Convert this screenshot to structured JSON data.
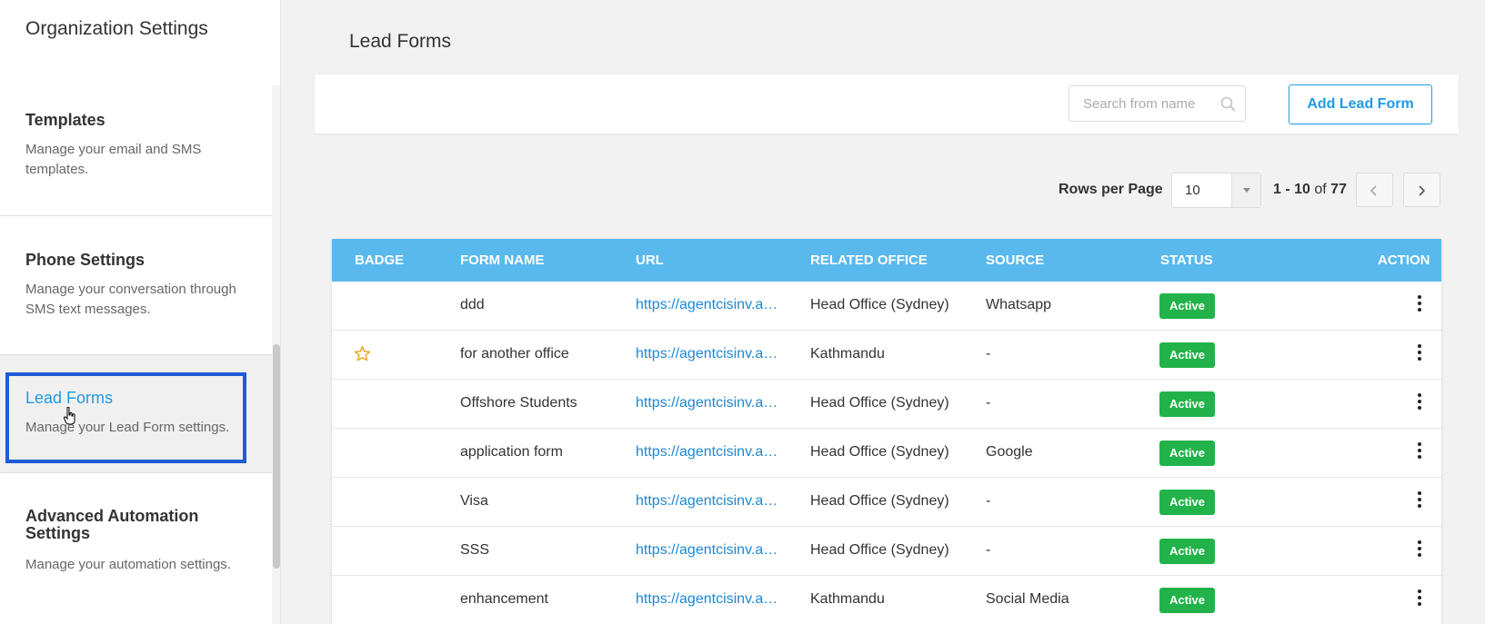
{
  "sidebar": {
    "title": "Organization Settings",
    "items": [
      {
        "title": "Templates",
        "desc": "Manage your email and SMS templates."
      },
      {
        "title": "Phone Settings",
        "desc": "Manage your conversation through SMS text messages."
      },
      {
        "title": "Lead Forms",
        "desc": "Manage your Lead Form settings."
      },
      {
        "title": "Advanced Automation Settings",
        "desc": "Manage your automation settings."
      }
    ]
  },
  "main": {
    "title": "Lead Forms",
    "search_placeholder": "Search from name",
    "add_button": "Add Lead Form"
  },
  "pagination": {
    "rows_label": "Rows per Page",
    "rows_value": "10",
    "range": "1 - 10",
    "of_label": "of",
    "total": "77"
  },
  "table": {
    "headers": {
      "badge": "BADGE",
      "form_name": "FORM NAME",
      "url": "URL",
      "office": "RELATED OFFICE",
      "source": "SOURCE",
      "status": "STATUS",
      "action": "ACTION"
    },
    "rows": [
      {
        "badge": "",
        "name": "ddd",
        "url": "https://agentcisinv.ag...",
        "office": "Head Office (Sydney)",
        "source": "Whatsapp",
        "status": "Active"
      },
      {
        "badge": "star",
        "name": "for another office",
        "url": "https://agentcisinv.ag...",
        "office": "Kathmandu",
        "source": "-",
        "status": "Active"
      },
      {
        "badge": "",
        "name": "Offshore Students",
        "url": "https://agentcisinv.ag...",
        "office": "Head Office (Sydney)",
        "source": "-",
        "status": "Active"
      },
      {
        "badge": "",
        "name": "application form",
        "url": "https://agentcisinv.ag...",
        "office": "Head Office (Sydney)",
        "source": "Google",
        "status": "Active"
      },
      {
        "badge": "",
        "name": "Visa",
        "url": "https://agentcisinv.ag...",
        "office": "Head Office (Sydney)",
        "source": "-",
        "status": "Active"
      },
      {
        "badge": "",
        "name": "SSS",
        "url": "https://agentcisinv.ag...",
        "office": "Head Office (Sydney)",
        "source": "-",
        "status": "Active"
      },
      {
        "badge": "",
        "name": "enhancement",
        "url": "https://agentcisinv.ag...",
        "office": "Kathmandu",
        "source": "Social Media",
        "status": "Active"
      }
    ]
  },
  "colors": {
    "accent": "#1e9be6",
    "header": "#5ab9ec",
    "active_status": "#21b349",
    "focus_outline": "#1f5bd8",
    "star": "#f0a020"
  }
}
